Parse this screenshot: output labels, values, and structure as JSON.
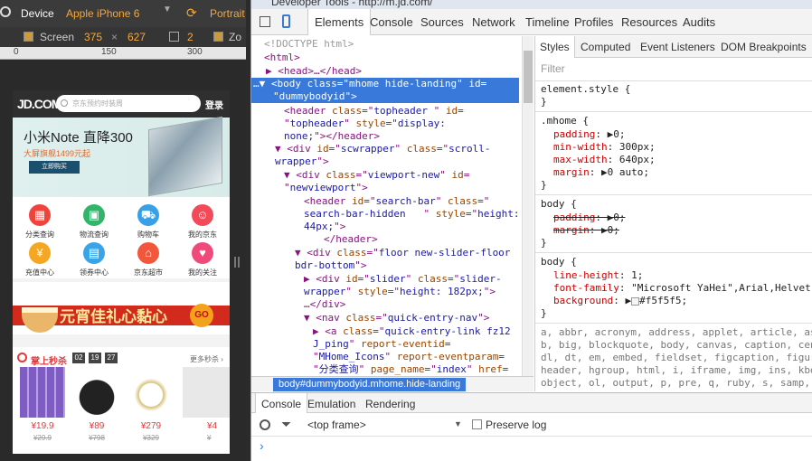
{
  "emulation": {
    "device_label": "Device",
    "device_value": "Apple iPhone 6",
    "orientation": "Portrait",
    "screen_label": "Screen",
    "width": "375",
    "times": "×",
    "height": "627",
    "dpr": "2",
    "zoom": "Zo"
  },
  "ruler": {
    "t0": "0",
    "t1": "150",
    "t2": "300"
  },
  "phone": {
    "logo": "JD.COM",
    "search_placeholder": "京东预约时装周",
    "login": "登录",
    "banner_title": "小米Note 直降300",
    "banner_sub": "大屏旗舰1499元起",
    "banner_btn": "立即购买",
    "quick": [
      "分类查询",
      "物流查询",
      "购物车",
      "我的京东",
      "充值中心",
      "领券中心",
      "京东超市",
      "我的关注"
    ],
    "promo_text": "元宵佳礼心黏心",
    "promo_go": "GO",
    "seckill_title": "掌上秒杀",
    "seckill_h": "02",
    "seckill_m": "19",
    "seckill_s": "27",
    "seckill_more": "更多秒杀 ›",
    "prices": [
      "¥19.9",
      "¥89",
      "¥279",
      "¥4"
    ],
    "orig": [
      "¥29.9",
      "¥798",
      "¥329",
      "¥"
    ]
  },
  "devtools": {
    "title": "Developer Tools - http://m.jd.com/",
    "tabs": [
      "Elements",
      "Console",
      "Sources",
      "Network",
      "Timeline",
      "Profiles",
      "Resources",
      "Audits"
    ],
    "breadcrumb": "body#dummybodyid.mhome.hide-landing",
    "styles_tabs": [
      "Styles",
      "Computed",
      "Event Listeners",
      "DOM Breakpoints"
    ],
    "filter": "Filter",
    "console_tabs": [
      "Console",
      "Emulation",
      "Rendering"
    ],
    "frame": "<top frame>",
    "preserve": "Preserve log",
    "prompt": "›"
  },
  "colors": {
    "selection": "#3879d9",
    "accent": "#f5a73c",
    "jd_red": "#e4393c"
  }
}
